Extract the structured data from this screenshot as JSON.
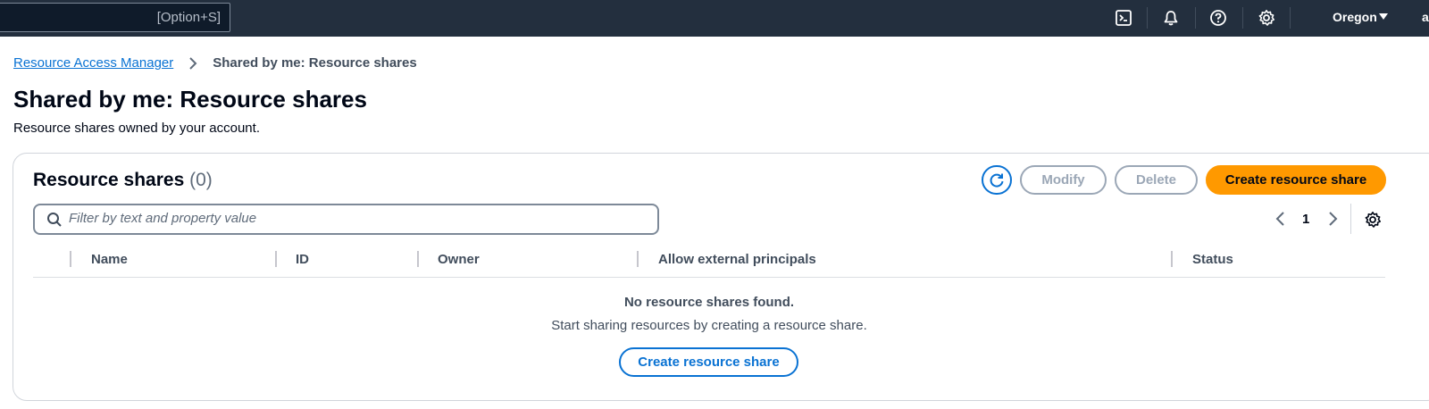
{
  "topnav": {
    "search_shortcut": "[Option+S]",
    "icons": [
      "cloudshell-icon",
      "notifications-bell-icon",
      "help-icon",
      "settings-gear-icon"
    ],
    "region": "Oregon",
    "account": "a"
  },
  "breadcrumb": {
    "parent": "Resource Access Manager",
    "current": "Shared by me: Resource shares"
  },
  "page": {
    "title": "Shared by me: Resource shares",
    "description": "Resource shares owned by your account."
  },
  "panel": {
    "title": "Resource shares",
    "count": "(0)",
    "buttons": {
      "modify": "Modify",
      "delete": "Delete",
      "create": "Create resource share"
    },
    "filter_placeholder": "Filter by text and property value",
    "page_number": "1",
    "columns": [
      "Name",
      "ID",
      "Owner",
      "Allow external principals",
      "Status"
    ],
    "empty": {
      "title": "No resource shares found.",
      "description": "Start sharing resources by creating a resource share.",
      "button": "Create resource share"
    }
  },
  "colors": {
    "nav_bg": "#232f3e",
    "link": "#0972d3",
    "primary": "#ff9900",
    "disabled": "#9ba7b6"
  }
}
